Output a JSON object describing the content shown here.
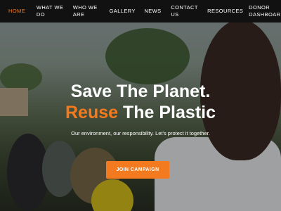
{
  "nav": {
    "items": [
      {
        "label": "HOME",
        "active": true
      },
      {
        "label": "WHAT WE DO"
      },
      {
        "label": "WHO WE ARE"
      },
      {
        "label": "GALLERY"
      },
      {
        "label": "NEWS"
      },
      {
        "label": "CONTACT US"
      },
      {
        "label": "RESOURCES"
      },
      {
        "label": "DONOR DASHBOARD"
      }
    ]
  },
  "hero": {
    "line1": "Save The Planet.",
    "line2_accent": "Reuse",
    "line2_rest": " The Plastic",
    "tagline": "Our environment, our responsibility. Let's protect it together.",
    "cta_label": "JOIN CAMPAIGN"
  },
  "colors": {
    "accent": "#f47a1f",
    "nav_bg": "#111111"
  }
}
